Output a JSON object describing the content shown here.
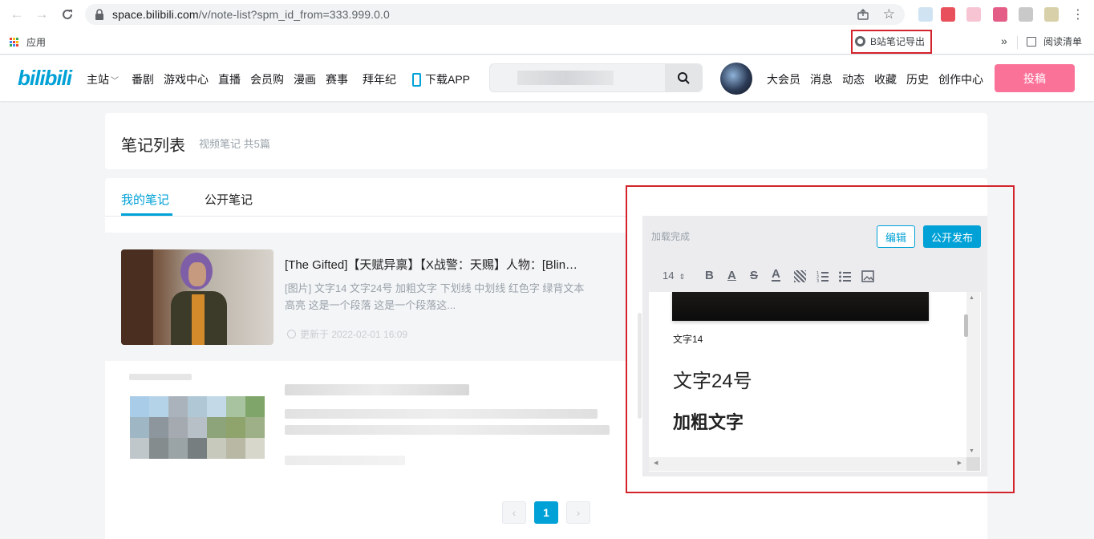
{
  "browser": {
    "url_host": "space.bilibili.com",
    "url_path": "/v/note-list?spm_id_from=333.999.0.0",
    "bookmarks": {
      "apps_label": "应用",
      "export_ext_label": "B站笔记导出",
      "reading_list_label": "阅读清单",
      "more_label": "»"
    }
  },
  "header": {
    "nav": [
      "主站",
      "番剧",
      "游戏中心",
      "直播",
      "会员购",
      "漫画",
      "赛事",
      "拜年纪",
      "下载APP"
    ],
    "right_nav": [
      "大会员",
      "消息",
      "动态",
      "收藏",
      "历史",
      "创作中心"
    ],
    "upload_label": "投稿"
  },
  "page": {
    "title": "笔记列表",
    "subtitle": "视频笔记 共5篇",
    "tabs": [
      "我的笔记",
      "公开笔记"
    ]
  },
  "notes": [
    {
      "title": "[The Gifted]【天赋异禀】【X战警：天赐】人物：[Blin…",
      "summary_line1": "[图片] 文字14 文字24号 加粗文字 下划线 中划线 红色字 绿背文本",
      "summary_line2": "高亮 这是一个段落 这是一个段落这...",
      "updated": "更新于 2022-02-01 16:09"
    }
  ],
  "pagination": {
    "current": "1",
    "prev": "‹",
    "next": "›"
  },
  "editor": {
    "status": "加载完成",
    "edit_label": "编辑",
    "publish_label": "公开发布",
    "font_size": "14",
    "toolbar_icons": [
      "B",
      "A",
      "S",
      "A"
    ],
    "doc_lines": [
      "文字14",
      "文字24号",
      "加粗文字"
    ]
  }
}
